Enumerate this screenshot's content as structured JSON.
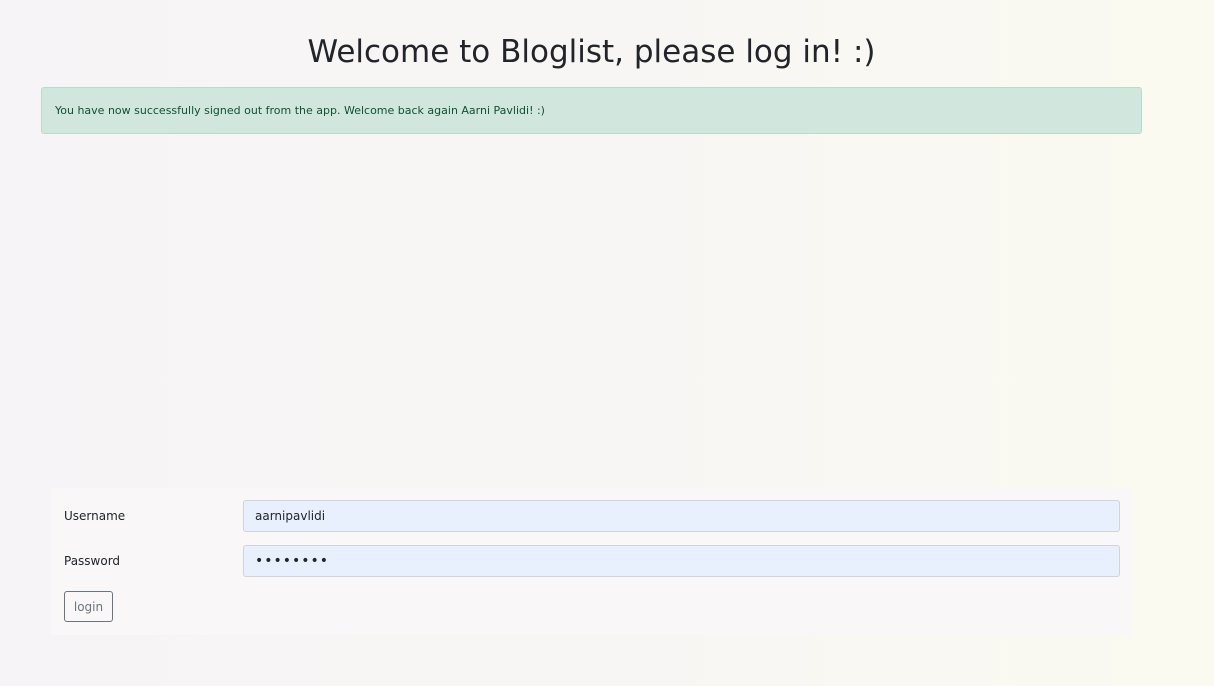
{
  "header": {
    "title": "Welcome to Bloglist, please log in! :)"
  },
  "notification": {
    "message": "You have now successfully signed out from the app. Welcome back again Aarni Pavlidi! :)",
    "type": "success",
    "background_color": "#d1e7dd",
    "text_color": "#0f5132"
  },
  "login_form": {
    "username_label": "Username",
    "username_value": "aarnipavlidi",
    "password_label": "Password",
    "password_value": "••••••••",
    "submit_label": "login"
  }
}
